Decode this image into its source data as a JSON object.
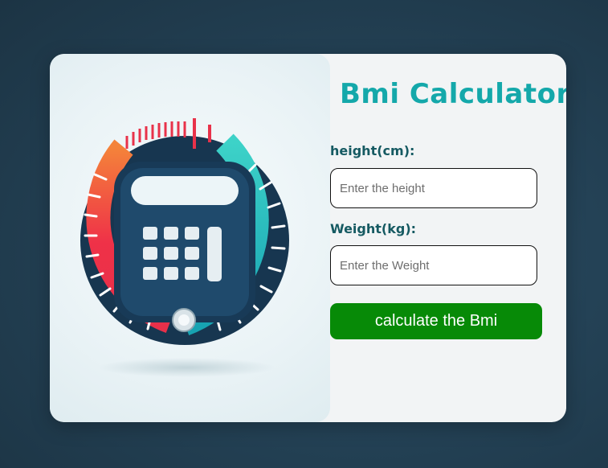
{
  "app": {
    "title": "Bmi Calculator"
  },
  "form": {
    "height_label": "height(cm):",
    "height_value": "",
    "height_placeholder": "Enter the height",
    "weight_label": "Weight(kg):",
    "weight_value": "",
    "weight_placeholder": "Enter the Weight",
    "submit_label": "calculate the Bmi"
  },
  "illustration": {
    "icon": "calculator-gauge-icon"
  },
  "colors": {
    "title": "#14a8aa",
    "label": "#165a62",
    "button": "#078a07",
    "card": "#f2f4f5"
  }
}
